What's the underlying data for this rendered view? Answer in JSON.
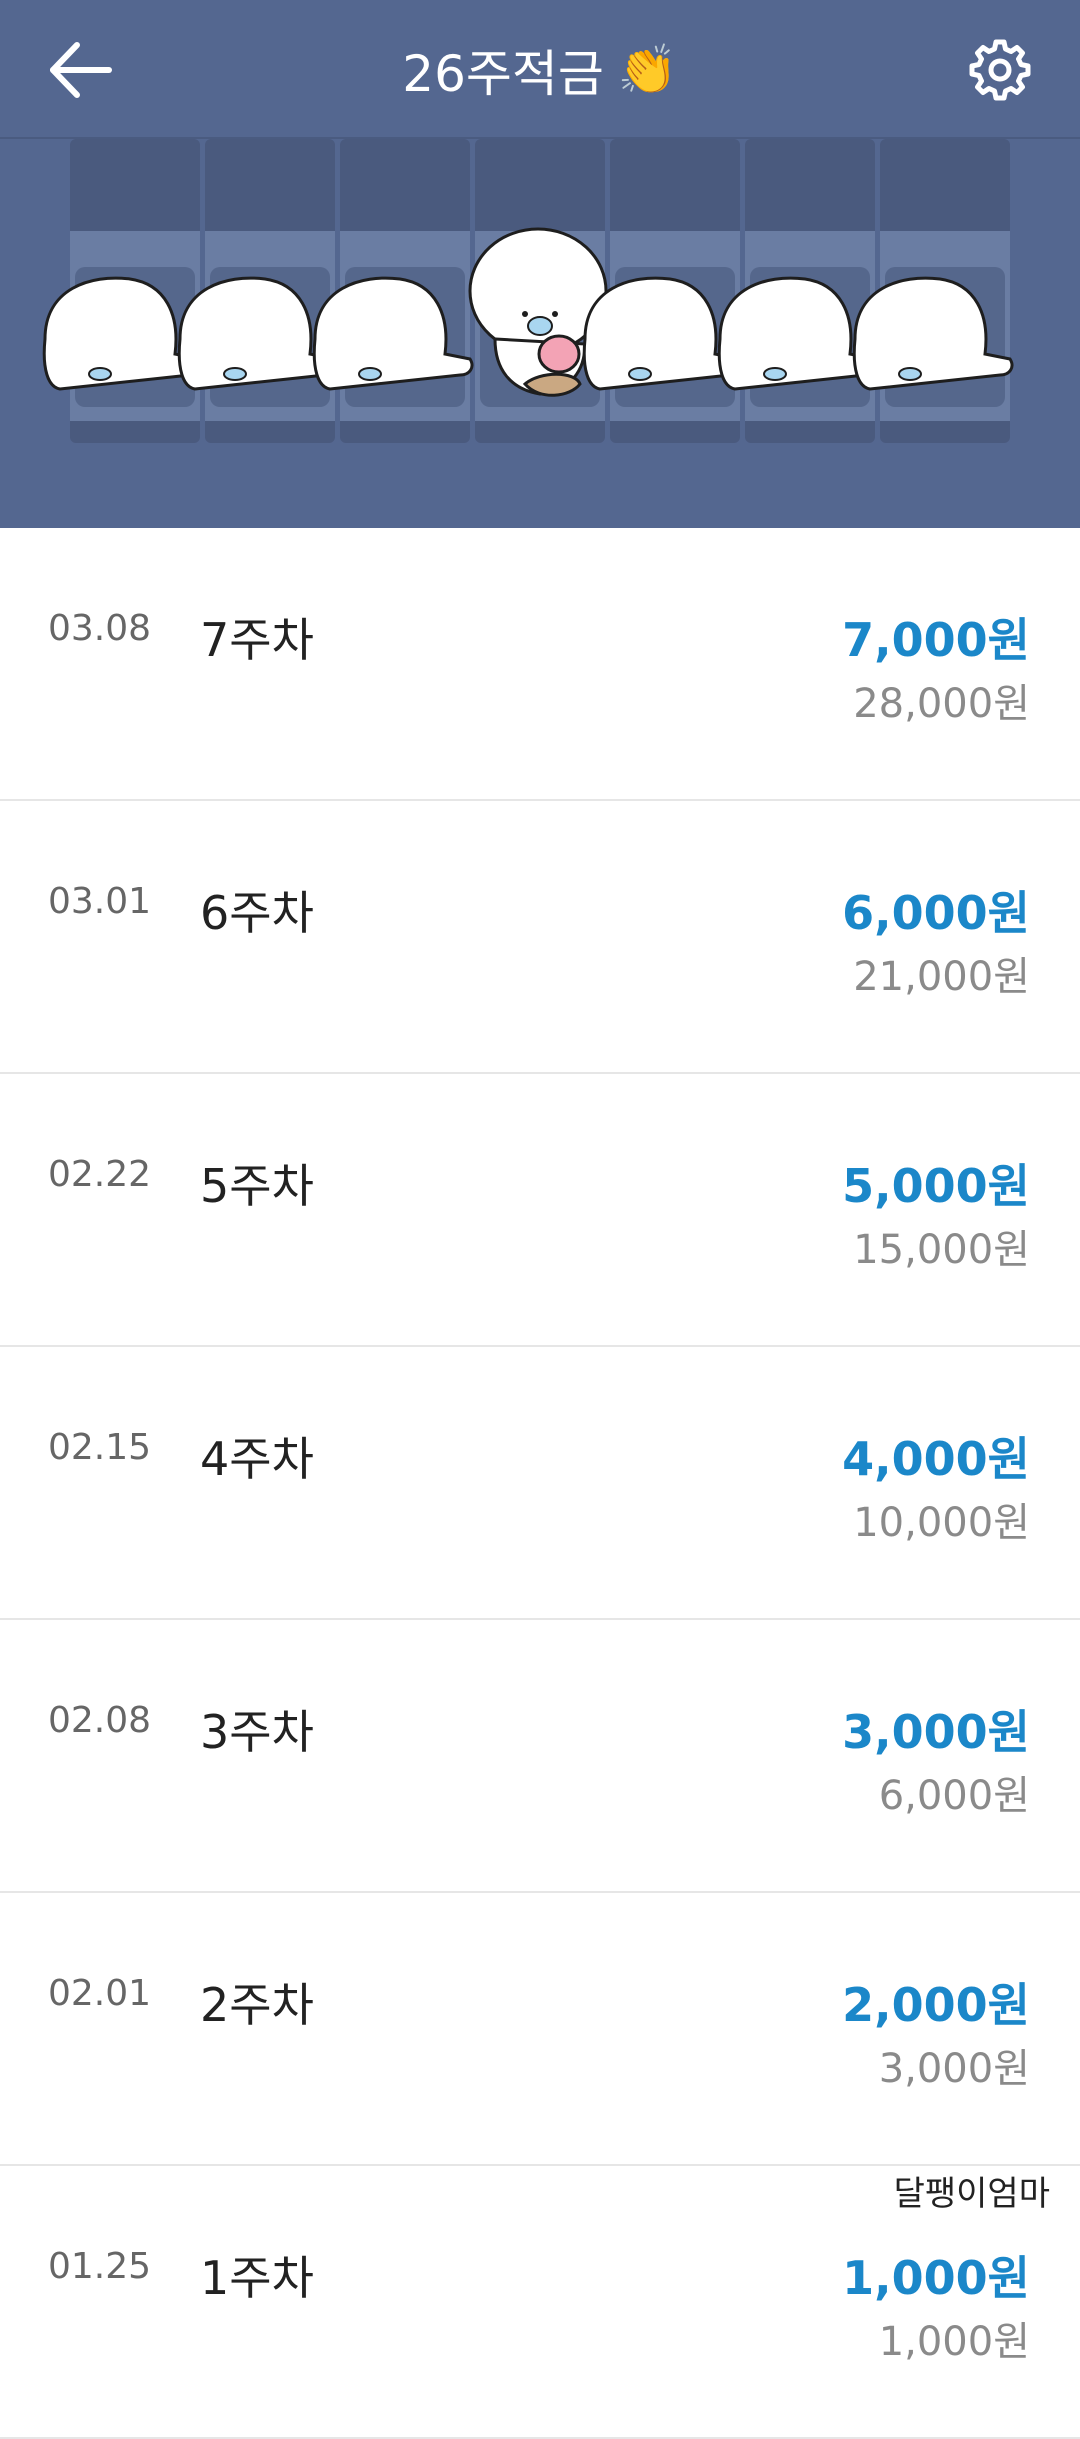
{
  "header": {
    "title": "26주적금",
    "title_emoji": "👏",
    "back_icon": "arrow-left-icon",
    "settings_icon": "gear-icon"
  },
  "colors": {
    "header_bg": "#546790",
    "amount_blue": "#1b87c9",
    "total_gray": "#8a8a8a"
  },
  "entries": [
    {
      "date": "03.08",
      "week": "7주차",
      "amount": "7,000원",
      "total": "28,000원"
    },
    {
      "date": "03.01",
      "week": "6주차",
      "amount": "6,000원",
      "total": "21,000원"
    },
    {
      "date": "02.22",
      "week": "5주차",
      "amount": "5,000원",
      "total": "15,000원"
    },
    {
      "date": "02.15",
      "week": "4주차",
      "amount": "4,000원",
      "total": "10,000원"
    },
    {
      "date": "02.08",
      "week": "3주차",
      "amount": "3,000원",
      "total": "6,000원"
    },
    {
      "date": "02.01",
      "week": "2주차",
      "amount": "2,000원",
      "total": "3,000원"
    },
    {
      "date": "01.25",
      "week": "1주차",
      "amount": "1,000원",
      "total": "1,000원"
    }
  ],
  "watermark": "달팽이엄마"
}
